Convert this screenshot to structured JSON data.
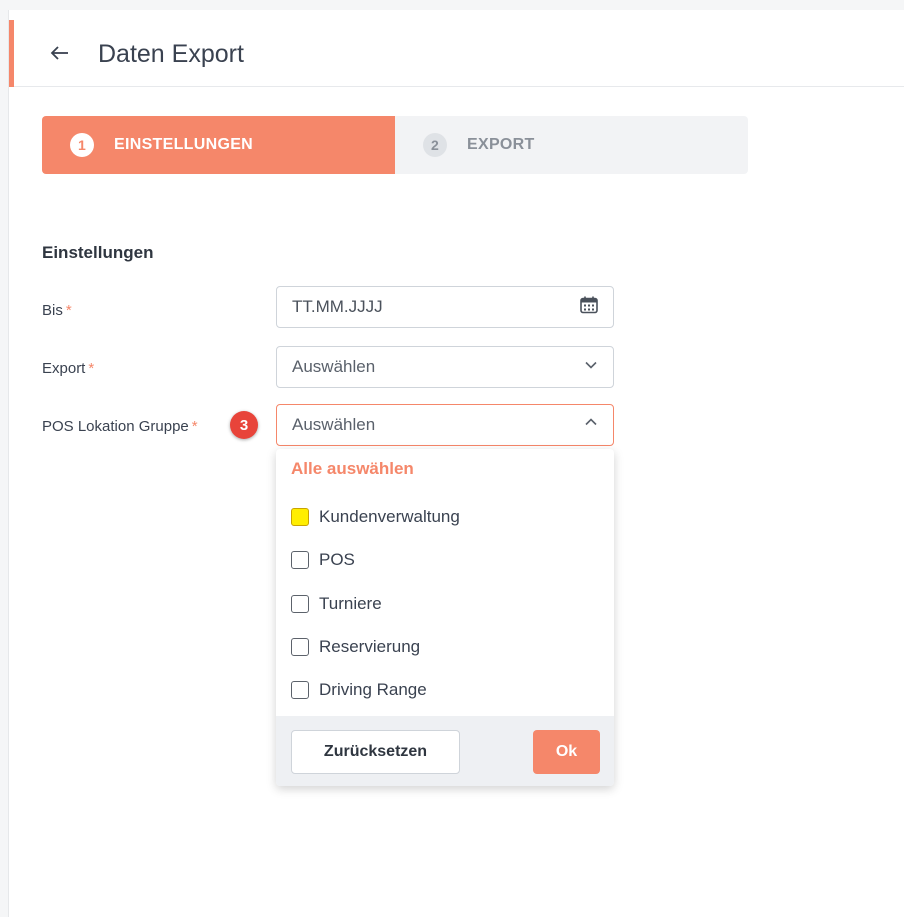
{
  "header": {
    "back_icon": "arrow-left-icon",
    "title": "Daten Export"
  },
  "stepper": {
    "steps": [
      {
        "number": "1",
        "label": "EINSTELLUNGEN",
        "active": true
      },
      {
        "number": "2",
        "label": "EXPORT",
        "active": false
      }
    ]
  },
  "form": {
    "section_title": "Einstellungen",
    "required_marker": "*",
    "bis": {
      "label": "Bis",
      "placeholder": "TT.MM.JJJJ",
      "icon": "calendar-icon"
    },
    "export": {
      "label": "Export",
      "value": "Auswählen",
      "icon": "chevron-down-icon"
    },
    "pos_gruppe": {
      "label": "POS Lokation Gruppe",
      "value": "Auswählen",
      "icon": "chevron-up-icon"
    }
  },
  "annotation": {
    "badge": "3"
  },
  "dropdown": {
    "select_all": "Alle auswählen",
    "options": [
      {
        "label": "Kundenverwaltung",
        "checked": false,
        "highlighted": true
      },
      {
        "label": "POS",
        "checked": false
      },
      {
        "label": "Turniere",
        "checked": false
      },
      {
        "label": "Reservierung",
        "checked": false
      },
      {
        "label": "Driving Range",
        "checked": false
      }
    ],
    "reset_label": "Zurücksetzen",
    "ok_label": "Ok"
  },
  "colors": {
    "accent": "#f5876a",
    "badge": "#e8443a",
    "highlight": "#ffee00"
  }
}
